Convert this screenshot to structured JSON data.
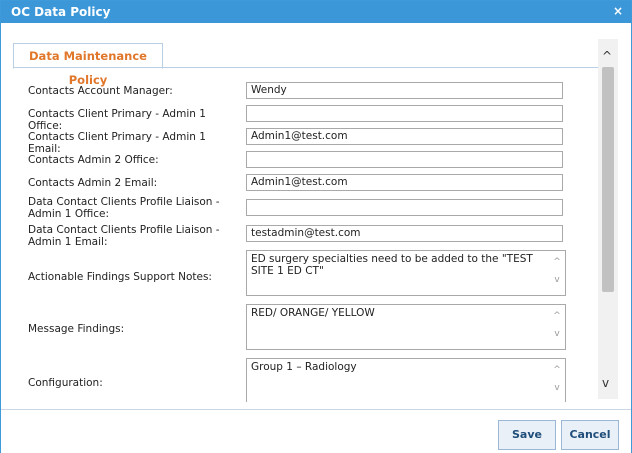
{
  "dialog": {
    "title": "OC Data Policy",
    "close": "×"
  },
  "tab": {
    "label": "Data Maintenance Policy"
  },
  "fields": [
    {
      "label": "Contacts Account Manager:",
      "value": "Wendy"
    },
    {
      "label": "Contacts Client Primary - Admin 1 Office:",
      "value": ""
    },
    {
      "label": "Contacts Client Primary - Admin 1 Email:",
      "value": "Admin1@test.com"
    },
    {
      "label": "Contacts Admin 2 Office:",
      "value": ""
    },
    {
      "label": "Contacts Admin 2 Email:",
      "value": "Admin1@test.com"
    },
    {
      "label": "Data Contact Clients Profile Liaison - Admin 1 Office:",
      "value": ""
    },
    {
      "label": "Data Contact Clients Profile Liaison - Admin 1 Email:",
      "value": "testadmin@test.com"
    }
  ],
  "textareas": [
    {
      "label": "Actionable Findings Support Notes:",
      "value": "ED surgery specialties need to be added to the \"TEST SITE 1 ED CT\""
    },
    {
      "label": "Message Findings:",
      "value": "RED/ ORANGE/ YELLOW"
    },
    {
      "label": "Configuration:",
      "value": "Group 1 – Radiology"
    }
  ],
  "buttons": {
    "save": "Save",
    "cancel": "Cancel"
  },
  "icons": {
    "up": "^",
    "down": "v"
  }
}
